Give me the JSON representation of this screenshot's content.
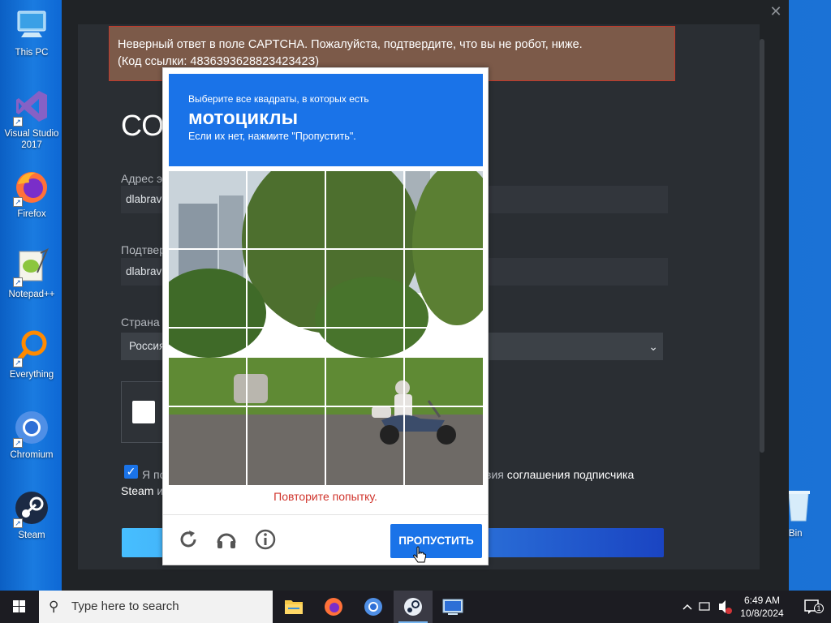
{
  "desktop": {
    "icons": [
      {
        "label": "This PC",
        "icon": "computer-icon"
      },
      {
        "label": "Visual Studio 2017",
        "icon": "visual-studio-icon"
      },
      {
        "label": "Firefox",
        "icon": "firefox-icon"
      },
      {
        "label": "Notepad++",
        "icon": "notepadpp-icon"
      },
      {
        "label": "Everything",
        "icon": "everything-search-icon"
      },
      {
        "label": "Chromium",
        "icon": "chromium-icon"
      },
      {
        "label": "Steam",
        "icon": "steam-icon"
      }
    ],
    "recycle_bin_label": "cle Bin"
  },
  "steam": {
    "close_glyph": "✕",
    "error_line1": "Неверный ответ в поле CAPTCHA. Пожалуйста, подтвердите, что вы не робот, ниже.",
    "error_line2": "(Код ссылки: 483639362882342342З)",
    "heading": "СО",
    "email_label": "Адрес э",
    "email_value": "dlabrav",
    "confirm_label": "Подтвер",
    "confirm_value": "dlabrav",
    "country_label": "Страна",
    "country_value": "Россия",
    "agree_text_start": "Я по",
    "agree_text_mid": "вия",
    "agree_link": "соглашения подписчика",
    "agree_line2_start": "Steam",
    "agree_line2_rest": "и"
  },
  "captcha": {
    "instruction_small": "Выберите все квадраты, в которых есть",
    "target_word": "мотоциклы",
    "instruction_hint": "Если их нет, нажмите \"Пропустить\".",
    "retry_message": "Повторите попытку.",
    "skip_label": "ПРОПУСТИТЬ",
    "grid_rows": 4,
    "grid_cols": 4
  },
  "taskbar": {
    "search_placeholder": "Type here to search",
    "apps": [
      "file-explorer-icon",
      "firefox-icon",
      "chromium-icon",
      "steam-icon",
      "remote-desktop-icon"
    ],
    "time": "6:49 AM",
    "date": "10/8/2024",
    "notification_count": "1"
  }
}
